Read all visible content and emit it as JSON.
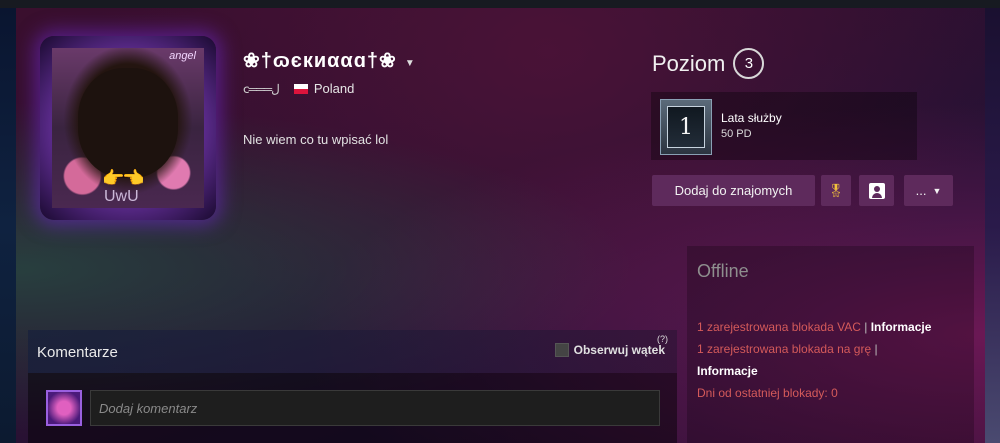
{
  "profile": {
    "name": "❀†ɷєкиααɑ†❀",
    "real_name": "ⅽ═══ل",
    "country": "Poland",
    "summary": "Nie wiem co tu wpisać lol",
    "avatar": {
      "tag_text": "angel",
      "caption": "UwU",
      "hands": "👉👈"
    }
  },
  "level": {
    "label": "Poziom",
    "value": "3"
  },
  "badge": {
    "number": "1",
    "title": "Lata służby",
    "xp": "50 PD"
  },
  "actions": {
    "add_friend": "Dodaj do znajomych",
    "more": "..."
  },
  "status": {
    "text": "Offline",
    "vac_ban": "1 zarejestrowana blokada VAC",
    "game_ban": "1 zarejestrowana blokada na grę",
    "info_label": "Informacje",
    "days_since": "Dni od ostatniej blokady: 0",
    "separator": "|"
  },
  "comments": {
    "title": "Komentarze",
    "subscribe_label": "Obserwuj wątek",
    "help": "(?)",
    "input_placeholder": "Dodaj komentarz"
  },
  "colors": {
    "accent_button": "#5e2a5c",
    "ban_text": "#d45a5a",
    "award_icon": "#f2c23c"
  },
  "icons": {
    "award": "award-ribbon-icon",
    "user": "user-card-icon",
    "caret": "chevron-down-icon"
  }
}
